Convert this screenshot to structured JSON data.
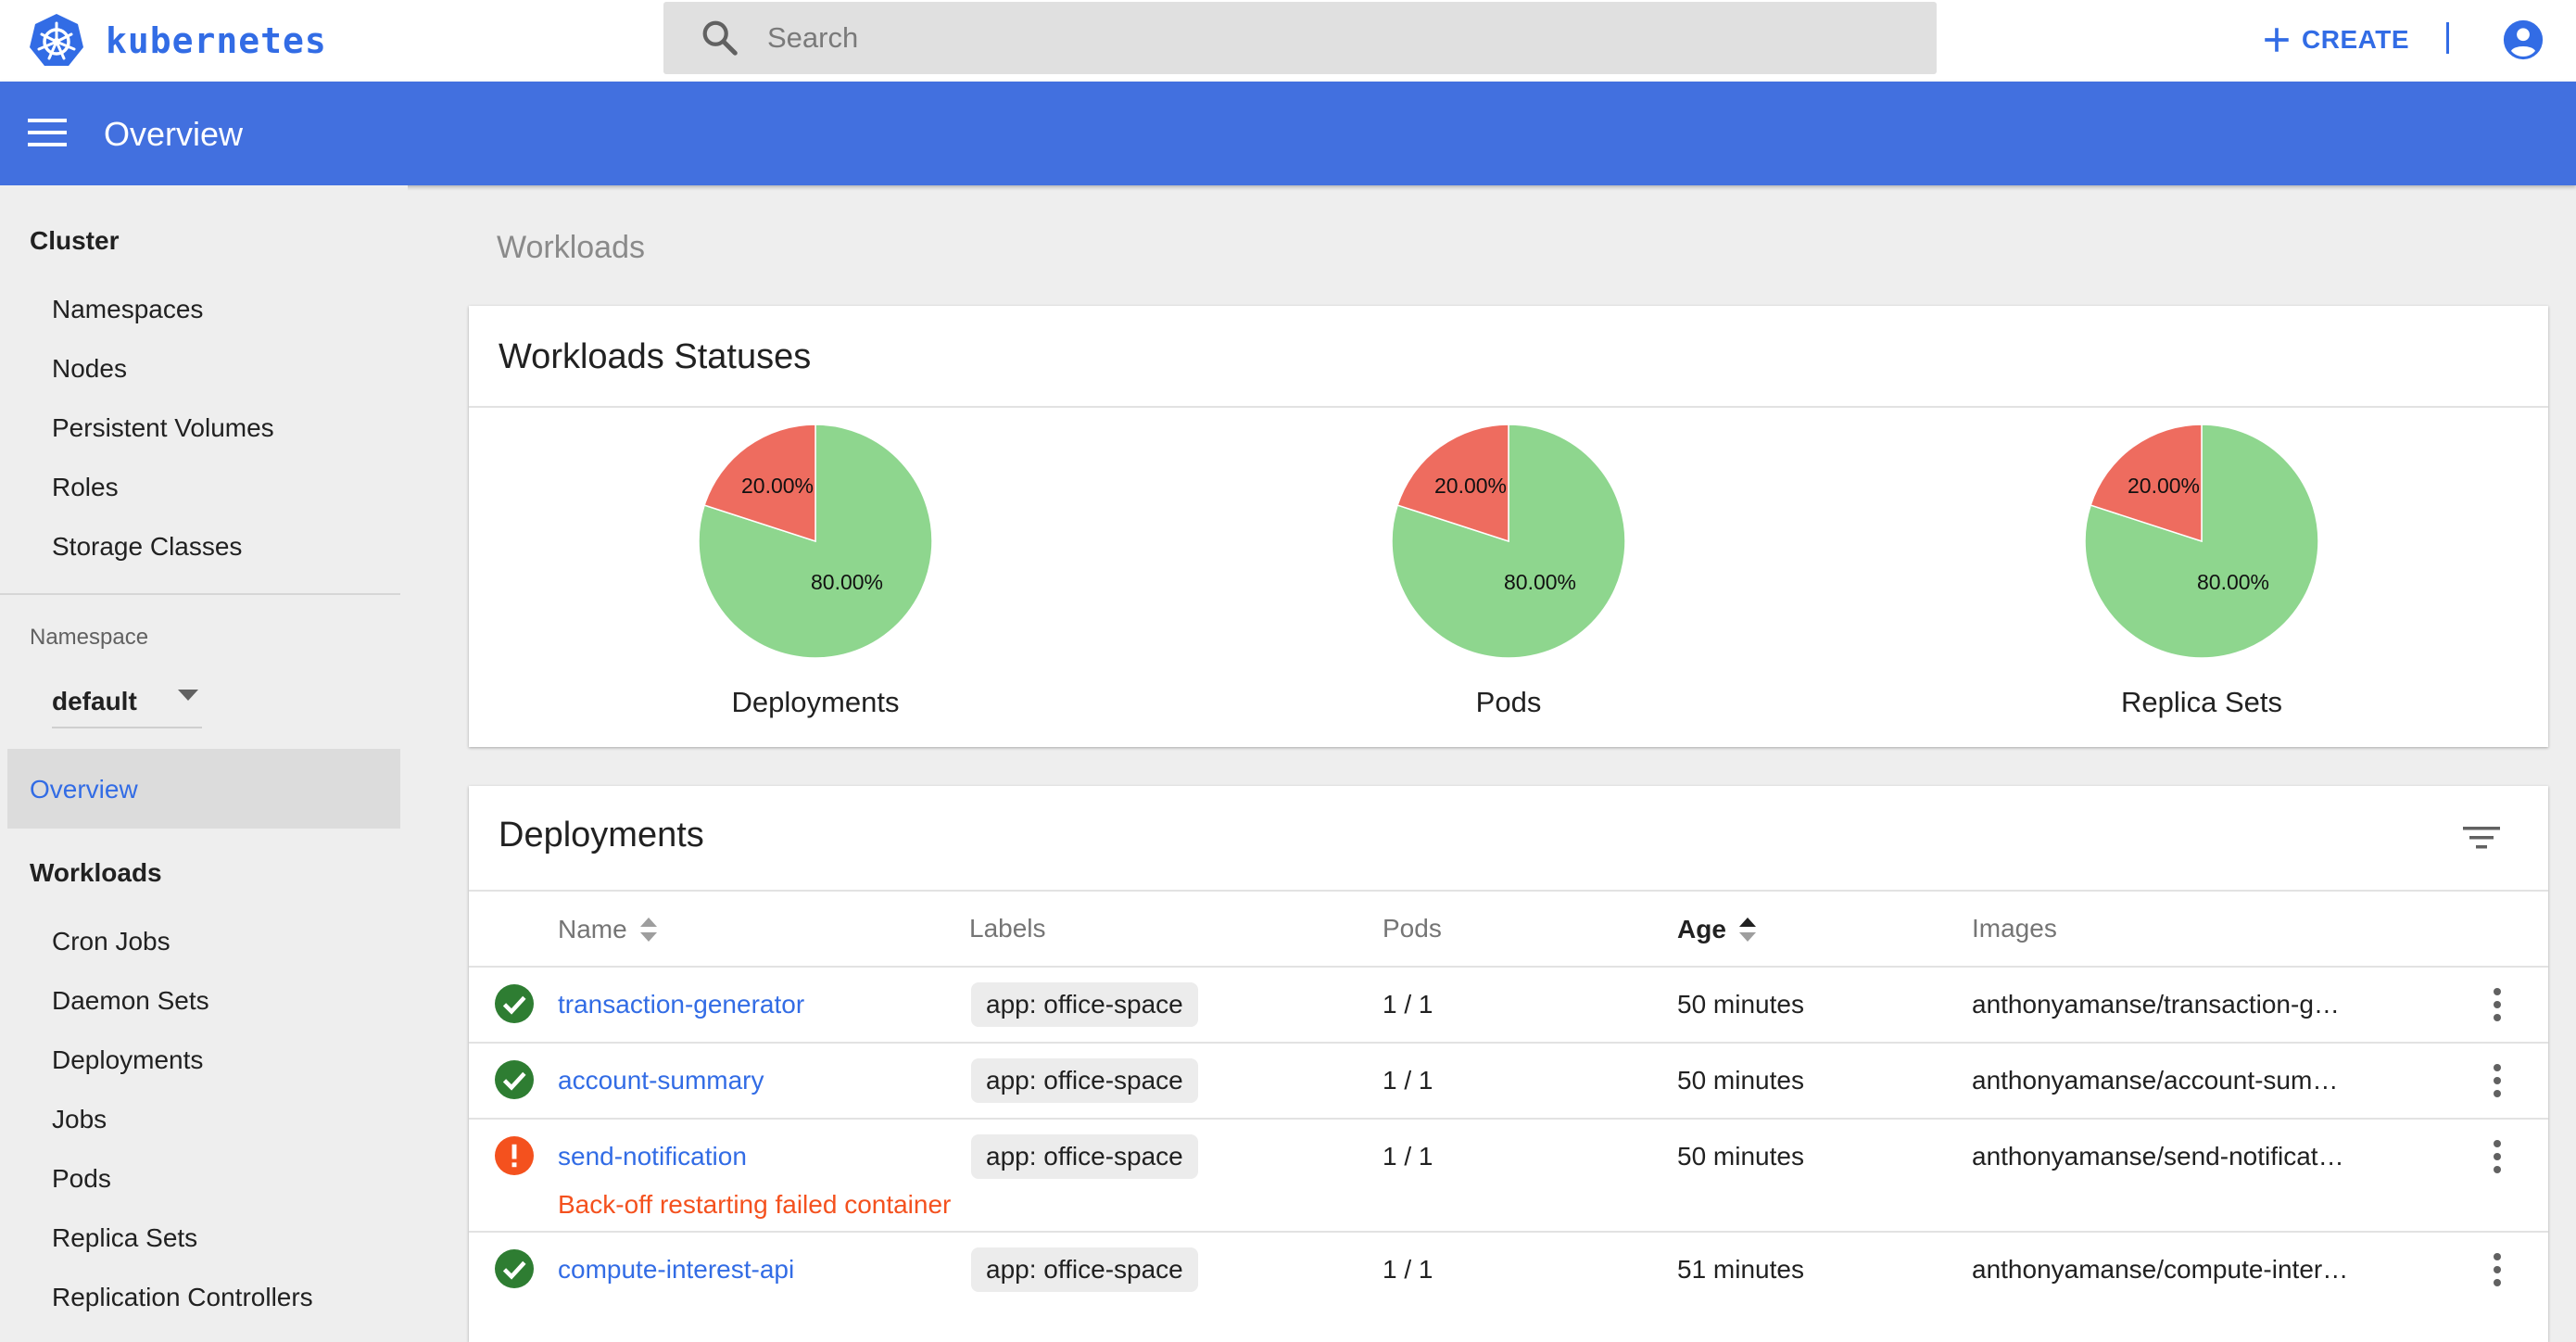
{
  "brand": {
    "name": "kubernetes"
  },
  "search": {
    "placeholder": "Search"
  },
  "topbar": {
    "create_label": "CREATE"
  },
  "appbar": {
    "title": "Overview"
  },
  "sidebar": {
    "cluster_heading": "Cluster",
    "cluster_items": [
      "Namespaces",
      "Nodes",
      "Persistent Volumes",
      "Roles",
      "Storage Classes"
    ],
    "namespace_label": "Namespace",
    "namespace_value": "default",
    "overview_label": "Overview",
    "workloads_heading": "Workloads",
    "workload_items": [
      "Cron Jobs",
      "Daemon Sets",
      "Deployments",
      "Jobs",
      "Pods",
      "Replica Sets",
      "Replication Controllers"
    ]
  },
  "main": {
    "breadcrumb": "Workloads"
  },
  "statuses": {
    "title": "Workloads Statuses",
    "colors": {
      "running": "#8ed68e",
      "failed": "#ee6c5f"
    },
    "charts": [
      {
        "caption": "Deployments",
        "failed_label": "20.00%",
        "running_label": "80.00%",
        "failed_fraction": 0.2
      },
      {
        "caption": "Pods",
        "failed_label": "20.00%",
        "running_label": "80.00%",
        "failed_fraction": 0.2
      },
      {
        "caption": "Replica Sets",
        "failed_label": "20.00%",
        "running_label": "80.00%",
        "failed_fraction": 0.2
      }
    ]
  },
  "deployments": {
    "title": "Deployments",
    "columns": {
      "name": "Name",
      "labels": "Labels",
      "pods": "Pods",
      "age": "Age",
      "images": "Images"
    },
    "rows": [
      {
        "status": "ok",
        "name": "transaction-generator",
        "label": "app: office-space",
        "pods": "1 / 1",
        "age": "50 minutes",
        "image": "anthonyamanse/transaction-g…"
      },
      {
        "status": "ok",
        "name": "account-summary",
        "label": "app: office-space",
        "pods": "1 / 1",
        "age": "50 minutes",
        "image": "anthonyamanse/account-sum…"
      },
      {
        "status": "error",
        "name": "send-notification",
        "label": "app: office-space",
        "pods": "1 / 1",
        "age": "50 minutes",
        "image": "anthonyamanse/send-notificat…",
        "error": "Back-off restarting failed container"
      },
      {
        "status": "ok",
        "name": "compute-interest-api",
        "label": "app: office-space",
        "pods": "1 / 1",
        "age": "51 minutes",
        "image": "anthonyamanse/compute-inter…"
      }
    ]
  }
}
